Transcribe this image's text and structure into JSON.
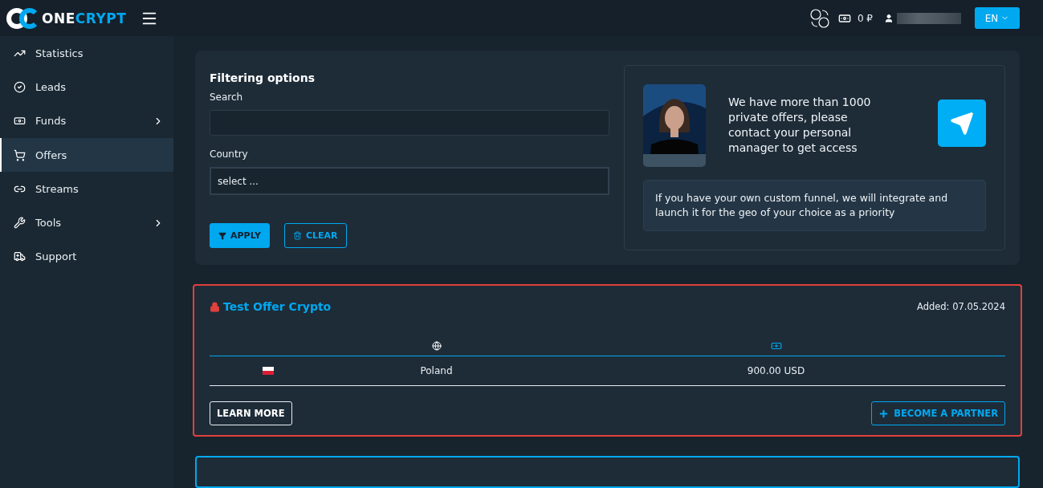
{
  "header": {
    "logo": {
      "part_1": "ONE",
      "part_2": "CRYPT"
    },
    "balance": "0 ₽",
    "language": "EN"
  },
  "sidebar": {
    "items": [
      {
        "label": "Statistics",
        "submenu": false,
        "selected": false
      },
      {
        "label": "Leads",
        "submenu": false,
        "selected": false
      },
      {
        "label": "Funds",
        "submenu": true,
        "selected": false
      },
      {
        "label": "Offers",
        "submenu": false,
        "selected": true
      },
      {
        "label": "Streams",
        "submenu": false,
        "selected": false
      },
      {
        "label": "Tools",
        "submenu": true,
        "selected": false
      },
      {
        "label": "Support",
        "submenu": false,
        "selected": false
      }
    ]
  },
  "filters": {
    "title": "Filtering options",
    "search": {
      "label": "Search"
    },
    "country": {
      "label": "Country",
      "value": "select ..."
    },
    "buttons": [
      {
        "label": "APPLY",
        "kind": "primary"
      },
      {
        "label": "CLEAR",
        "kind": "outline"
      }
    ]
  },
  "promo": {
    "message": "We have more than 1000 private offers, please contact your personal manager to get access",
    "note": "If you have your own custom funnel, we will integrate and launch it for the geo of your choice as a priority"
  },
  "offers": [
    {
      "title": "Test Offer Crypto",
      "added": "Added: 07.05.2024",
      "highlighted": true,
      "rows": [
        {
          "country": "Poland",
          "payout": "900.00 USD"
        }
      ],
      "buttons": [
        {
          "label": "LEARN MORE",
          "kind": "white"
        },
        {
          "label": "BECOME A PARTNER",
          "kind": "blue"
        }
      ]
    },
    {
      "highlighted": false
    }
  ]
}
